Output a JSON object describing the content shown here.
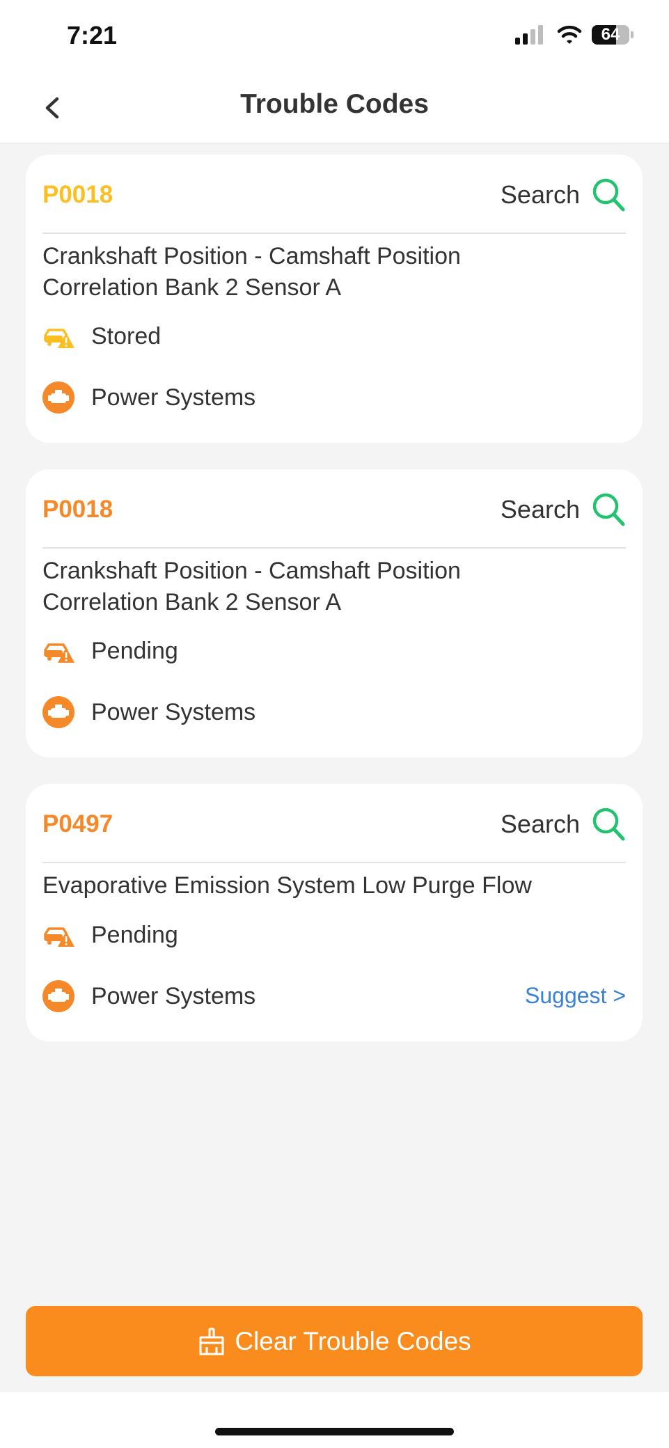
{
  "status": {
    "time": "7:21",
    "battery": "64",
    "battery_level": 0.64
  },
  "nav": {
    "title": "Trouble Codes"
  },
  "colors": {
    "stored": "#fbbf24",
    "pending": "#f5892a",
    "search_green": "#22c26e",
    "primary_orange": "#fa8c1e",
    "link_blue": "#3a82d6"
  },
  "cards": [
    {
      "code": "P0018",
      "search_label": "Search",
      "description_line1": "Crankshaft Position - Camshaft Position",
      "description_line2": "Correlation Bank 2 Sensor A",
      "status": "Stored",
      "status_icon": "car-warning-icon",
      "system": "Power Systems",
      "system_icon": "engine-icon"
    },
    {
      "code": "P0018",
      "search_label": "Search",
      "description_line1": "Crankshaft Position - Camshaft Position",
      "description_line2": "Correlation Bank 2 Sensor A",
      "status": "Pending",
      "status_icon": "car-warning-icon",
      "system": "Power Systems",
      "system_icon": "engine-icon"
    },
    {
      "code": "P0497",
      "search_label": "Search",
      "description_line1": "Evaporative Emission System Low Purge Flow",
      "status": "Pending",
      "status_icon": "car-warning-icon",
      "system": "Power Systems",
      "system_icon": "engine-icon",
      "suggest_label": "Suggest >"
    }
  ],
  "footer": {
    "clear_label": "Clear Trouble Codes",
    "clear_icon": "broom-icon"
  }
}
